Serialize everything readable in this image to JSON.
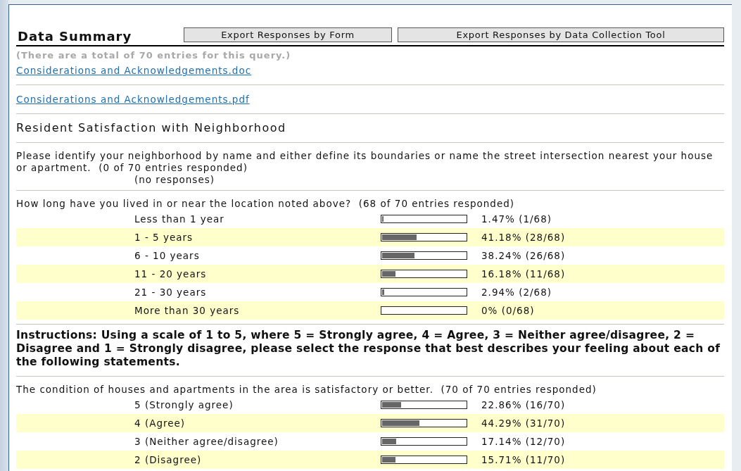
{
  "title": "Data Summary",
  "buttons": [
    "Export Responses by Form",
    "Export Responses by Data Collection Tool"
  ],
  "total_note": "(There are a total of 70 entries for this query.)",
  "attachments": [
    "Considerations and Acknowledgements.doc",
    "Considerations and Acknowledgements.pdf"
  ],
  "sections": [
    {
      "kind": "heading",
      "text": "Resident Satisfaction with Neighborhood"
    },
    {
      "kind": "open_question",
      "question": "Please identify your neighborhood by name and either define its boundaries or name the street intersection nearest your house or apartment.",
      "responded": "(0 of 70 entries responded)",
      "note": "(no responses)"
    },
    {
      "kind": "choice_question",
      "question": "How long have you lived in or near the location noted above?",
      "responded": "(68 of 70 entries responded)",
      "options": [
        {
          "label": "Less than 1 year",
          "level": 0.0147,
          "reading": "1.47% (1/68)"
        },
        {
          "label": "1 - 5 years",
          "level": 0.4118,
          "reading": "41.18% (28/68)"
        },
        {
          "label": "6 - 10 years",
          "level": 0.3824,
          "reading": "38.24% (26/68)"
        },
        {
          "label": "11 - 20 years",
          "level": 0.1618,
          "reading": "16.18% (11/68)"
        },
        {
          "label": "21 - 30 years",
          "level": 0.0294,
          "reading": "2.94% (2/68)"
        },
        {
          "label": "More than 30 years",
          "level": 0,
          "reading": "0% (0/68)"
        }
      ]
    },
    {
      "kind": "instructions",
      "text": "Instructions: Using a scale of 1 to 5, where 5 = Strongly agree, 4 = Agree, 3 = Neither agree/disagree, 2 = Disagree and 1 = Strongly disagree, please select the response that best describes your feeling about each of the following statements."
    },
    {
      "kind": "choice_question",
      "question": "The condition of houses and apartments in the area is satisfactory or better.",
      "responded": "(70 of 70 entries responded)",
      "options": [
        {
          "label": "5 (Strongly agree)",
          "level": 0.2286,
          "reading": "22.86% (16/70)"
        },
        {
          "label": "4 (Agree)",
          "level": 0.4429,
          "reading": "44.29% (31/70)"
        },
        {
          "label": "3 (Neither agree/disagree)",
          "level": 0.1714,
          "reading": "17.14% (12/70)"
        },
        {
          "label": "2 (Disagree)",
          "level": 0.1571,
          "reading": "15.71% (11/70)"
        }
      ]
    }
  ]
}
